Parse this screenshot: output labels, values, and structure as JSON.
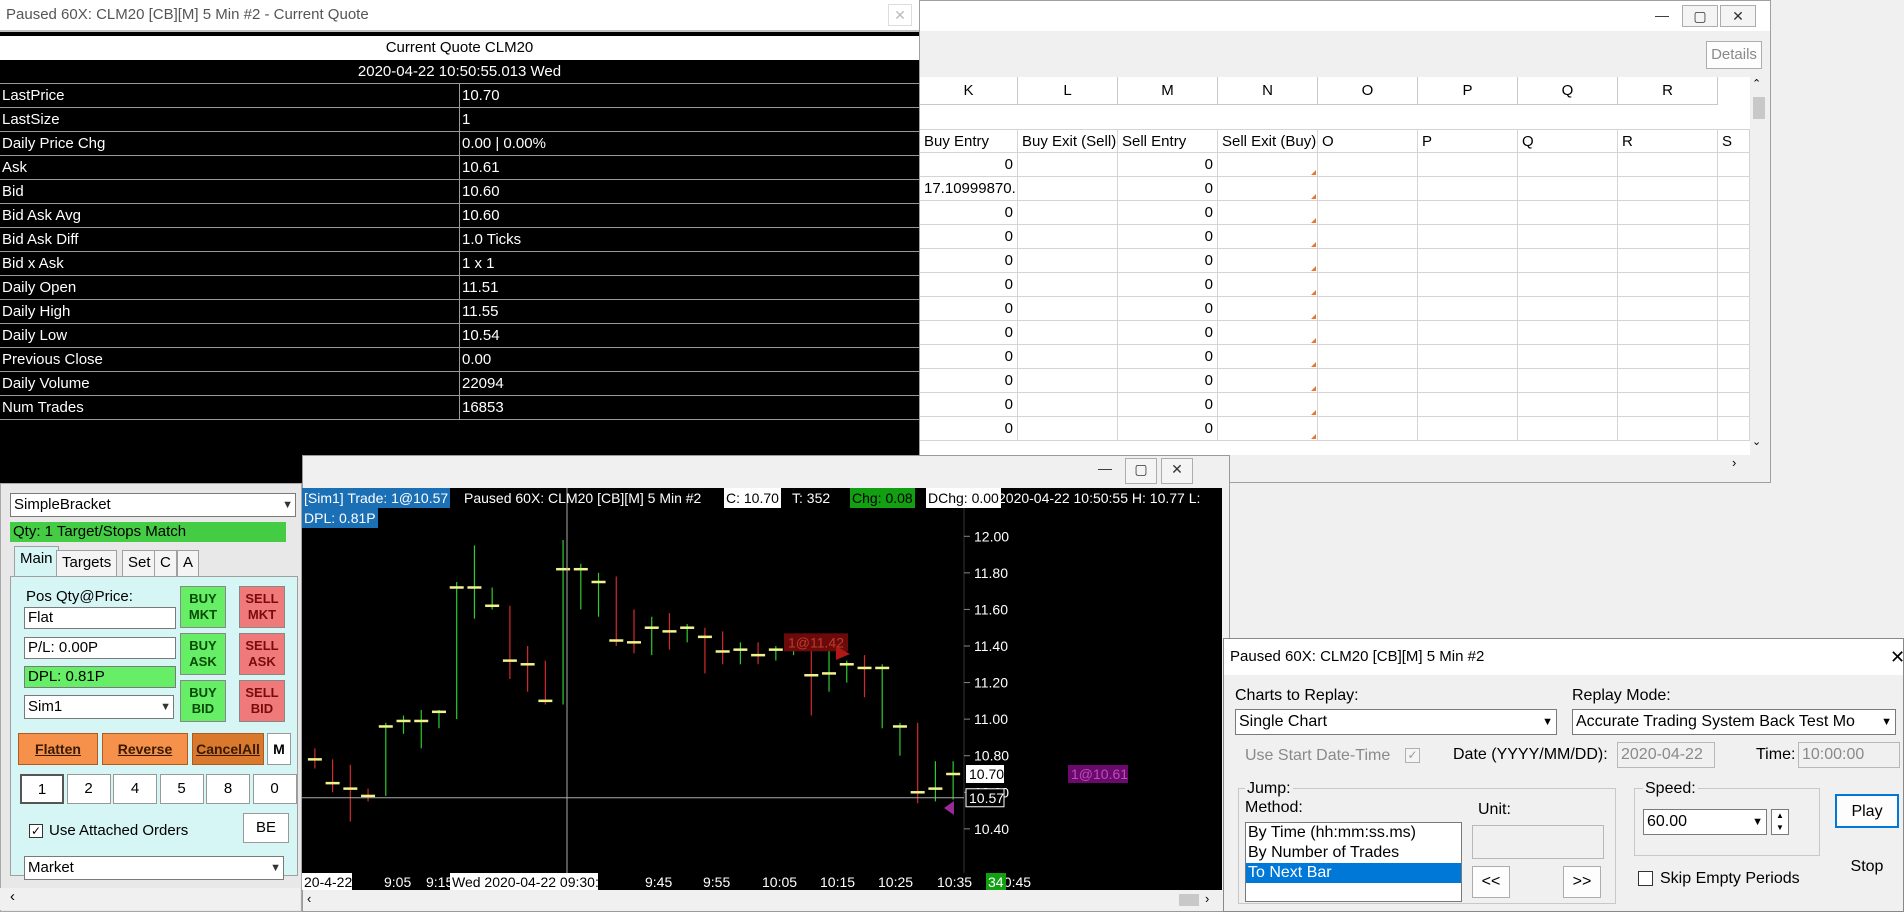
{
  "quote_window": {
    "title": "Paused 60X: CLM20 [CB][M]  5 Min   #2 - Current Quote",
    "heading": "Current Quote  CLM20",
    "datetime": "2020-04-22  10:50:55.013 Wed",
    "rows": [
      {
        "label": "LastPrice",
        "value": "10.70"
      },
      {
        "label": "LastSize",
        "value": "1"
      },
      {
        "label": "Daily Price Chg",
        "value": "0.00 | 0.00%"
      },
      {
        "label": "Ask",
        "value": "10.61"
      },
      {
        "label": "Bid",
        "value": "10.60"
      },
      {
        "label": "Bid Ask Avg",
        "value": "10.60"
      },
      {
        "label": "Bid Ask Diff",
        "value": "1.0 Ticks"
      },
      {
        "label": "Bid x Ask",
        "value": "1 x 1"
      },
      {
        "label": "Daily Open",
        "value": "11.51"
      },
      {
        "label": "Daily High",
        "value": "11.55"
      },
      {
        "label": "Daily Low",
        "value": "10.54"
      },
      {
        "label": "Previous Close",
        "value": "0.00"
      },
      {
        "label": "Daily Volume",
        "value": "22094"
      },
      {
        "label": "Num Trades",
        "value": "16853"
      }
    ]
  },
  "spreadsheet": {
    "details_label": "Details",
    "columns": [
      "K",
      "L",
      "M",
      "N",
      "O",
      "P",
      "Q",
      "R"
    ],
    "header_row": [
      "Buy Entry",
      "Buy Exit (Sell)",
      "Sell Entry",
      "Sell Exit (Buy)",
      "O",
      "P",
      "Q",
      "R",
      "S"
    ],
    "rows": [
      {
        "k": "0",
        "m": "0"
      },
      {
        "k": "17.10999870...",
        "m": "0"
      },
      {
        "k": "0",
        "m": "0"
      },
      {
        "k": "0",
        "m": "0"
      },
      {
        "k": "0",
        "m": "0"
      },
      {
        "k": "0",
        "m": "0"
      },
      {
        "k": "0",
        "m": "0"
      },
      {
        "k": "0",
        "m": "0"
      },
      {
        "k": "0",
        "m": "0"
      },
      {
        "k": "0",
        "m": "0"
      },
      {
        "k": "0",
        "m": "0"
      },
      {
        "k": "0",
        "m": "0"
      }
    ]
  },
  "trade_window": {
    "strategy": "SimpleBracket",
    "qty_status": "Qty: 1 Target/Stops Match",
    "tabs": [
      "Main",
      "Targets",
      "Set",
      "C",
      "A"
    ],
    "pos_label": "Pos Qty@Price:",
    "pos_value": "Flat",
    "pl_value": "P/L: 0.00P",
    "dpl_value": "DPL: 0.81P",
    "account": "Sim1",
    "buy_mkt": "BUY MKT",
    "sell_mkt": "SELL MKT",
    "buy_ask": "BUY ASK",
    "sell_ask": "SELL ASK",
    "buy_bid": "BUY BID",
    "sell_bid": "SELL BID",
    "flatten": "Flatten",
    "reverse": "Reverse",
    "cancel_all": "CancelAll",
    "m_label": "M",
    "quantities": [
      "1",
      "2",
      "4",
      "5",
      "8",
      "0"
    ],
    "use_attached_label": "Use Attached Orders",
    "be_label": "BE",
    "order_type": "Market"
  },
  "chart": {
    "info_sim": "[Sim1]  Trade: 1@10.57",
    "info_main": "Paused 60X: CLM20 [CB][M]  5 Min   #2",
    "info_c": "C: 10.70",
    "info_t": "T: 352",
    "info_chg": "Chg: 0.08",
    "info_dchg": "DChg: 0.00",
    "info_rest": "2020-04-22  10:50:55  H: 10.77  L:",
    "info_dpl": "DPL: 0.81P",
    "sell_marker": "1@11.42",
    "buy_marker": "1@10.61",
    "price_labels": [
      "12.00",
      "11.80",
      "11.60",
      "11.40",
      "11.20",
      "11.00",
      "10.80",
      "10.60",
      "10.40"
    ],
    "last_price": "10.70",
    "trade_price": "10.57",
    "time_labels": [
      "9:05",
      "9:15",
      "9:45",
      "9:55",
      "10:05",
      "10:15",
      "10:25",
      "10:35",
      "10:45"
    ],
    "date_left": "20-4-22",
    "cursor_time": "Wed 2020-04-22  09:30:00",
    "bar_count": "34"
  },
  "chart_data": {
    "type": "candlestick",
    "ylim": [
      10.35,
      12.1
    ],
    "candles": [
      {
        "t": "8:55",
        "o": 10.8,
        "h": 10.84,
        "l": 10.73,
        "c": 10.78
      },
      {
        "t": "9:00",
        "o": 10.68,
        "h": 10.78,
        "l": 10.6,
        "c": 10.65
      },
      {
        "t": "9:05",
        "o": 10.64,
        "h": 10.75,
        "l": 10.44,
        "c": 10.62
      },
      {
        "t": "9:10",
        "o": 10.6,
        "h": 10.62,
        "l": 10.55,
        "c": 10.58
      },
      {
        "t": "9:15",
        "o": 10.62,
        "h": 10.98,
        "l": 10.58,
        "c": 10.96
      },
      {
        "t": "9:20",
        "o": 10.96,
        "h": 11.02,
        "l": 10.92,
        "c": 10.99
      },
      {
        "t": "9:25",
        "o": 10.99,
        "h": 11.05,
        "l": 10.84,
        "c": 10.99
      },
      {
        "t": "9:30",
        "o": 11.0,
        "h": 11.05,
        "l": 10.95,
        "c": 11.04
      },
      {
        "t": "9:35",
        "o": 11.03,
        "h": 11.75,
        "l": 11.0,
        "c": 11.72
      },
      {
        "t": "9:40",
        "o": 11.72,
        "h": 11.95,
        "l": 11.55,
        "c": 11.72
      },
      {
        "t": "9:45",
        "o": 11.62,
        "h": 11.72,
        "l": 11.6,
        "c": 11.62
      },
      {
        "t": "9:50",
        "o": 11.6,
        "h": 11.62,
        "l": 11.22,
        "c": 11.32
      },
      {
        "t": "9:55",
        "o": 11.31,
        "h": 11.4,
        "l": 11.15,
        "c": 11.3
      },
      {
        "t": "10:00",
        "o": 11.11,
        "h": 11.32,
        "l": 11.08,
        "c": 11.1
      },
      {
        "t": "10:05",
        "o": 11.1,
        "h": 11.98,
        "l": 11.08,
        "c": 11.82
      },
      {
        "t": "10:10",
        "o": 11.82,
        "h": 11.85,
        "l": 11.6,
        "c": 11.82
      },
      {
        "t": "10:15",
        "o": 11.75,
        "h": 11.8,
        "l": 11.56,
        "c": 11.75
      },
      {
        "t": "10:20",
        "o": 11.75,
        "h": 11.78,
        "l": 11.4,
        "c": 11.43
      },
      {
        "t": "10:25",
        "o": 11.43,
        "h": 11.6,
        "l": 11.36,
        "c": 11.42
      },
      {
        "t": "10:30",
        "o": 11.42,
        "h": 11.56,
        "l": 11.35,
        "c": 11.5
      },
      {
        "t": "10:35",
        "o": 11.5,
        "h": 11.58,
        "l": 11.38,
        "c": 11.48
      },
      {
        "t": "10:40",
        "o": 11.48,
        "h": 11.52,
        "l": 11.42,
        "c": 11.5
      },
      {
        "t": "10:45",
        "o": 11.48,
        "h": 11.5,
        "l": 11.25,
        "c": 11.45
      },
      {
        "t": "10:50",
        "o": 11.45,
        "h": 11.48,
        "l": 11.3,
        "c": 11.37
      },
      {
        "t": "10:55",
        "o": 11.37,
        "h": 11.42,
        "l": 11.3,
        "c": 11.38
      },
      {
        "t": "11:00",
        "o": 11.38,
        "h": 11.42,
        "l": 11.3,
        "c": 11.35
      },
      {
        "t": "11:05",
        "o": 11.35,
        "h": 11.4,
        "l": 11.32,
        "c": 11.38
      },
      {
        "t": "11:10",
        "o": 11.38,
        "h": 11.42,
        "l": 11.35,
        "c": 11.4
      },
      {
        "t": "11:15",
        "o": 11.4,
        "h": 11.42,
        "l": 11.02,
        "c": 11.24
      },
      {
        "t": "11:20",
        "o": 11.24,
        "h": 11.4,
        "l": 11.15,
        "c": 11.25
      },
      {
        "t": "11:25",
        "o": 11.25,
        "h": 11.32,
        "l": 11.2,
        "c": 11.3
      },
      {
        "t": "11:30",
        "o": 11.3,
        "h": 11.35,
        "l": 11.12,
        "c": 11.28
      },
      {
        "t": "11:35",
        "o": 11.28,
        "h": 11.3,
        "l": 10.95,
        "c": 11.28
      },
      {
        "t": "11:40",
        "o": 10.96,
        "h": 10.98,
        "l": 10.8,
        "c": 10.96
      },
      {
        "t": "11:45",
        "o": 10.96,
        "h": 10.98,
        "l": 10.54,
        "c": 10.6
      },
      {
        "t": "11:50",
        "o": 10.6,
        "h": 10.77,
        "l": 10.55,
        "c": 10.62
      },
      {
        "t": "11:55",
        "o": 10.62,
        "h": 10.77,
        "l": 10.56,
        "c": 10.7
      }
    ]
  },
  "replay_window": {
    "title": "Paused 60X: CLM20 [CB][M]  5 Min   #2",
    "charts_label": "Charts to Replay:",
    "charts_value": "Single Chart",
    "mode_label": "Replay Mode:",
    "mode_value": "Accurate Trading System Back Test Mo",
    "use_start_label": "Use Start Date-Time",
    "date_label": "Date (YYYY/MM/DD):",
    "date_value": "2020-04-22",
    "time_label": "Time:",
    "time_value": "10:00:00",
    "jump_label": "Jump:",
    "method_label": "Method:",
    "unit_label": "Unit:",
    "methods": [
      "By Time (hh:mm:ss.ms)",
      "By Number of Trades",
      "To Next Bar"
    ],
    "back_button": "<<",
    "fwd_button": ">>",
    "speed_label": "Speed:",
    "speed_value": "60.00",
    "skip_label": "Skip Empty Periods",
    "play_label": "Play",
    "stop_label": "Stop"
  }
}
